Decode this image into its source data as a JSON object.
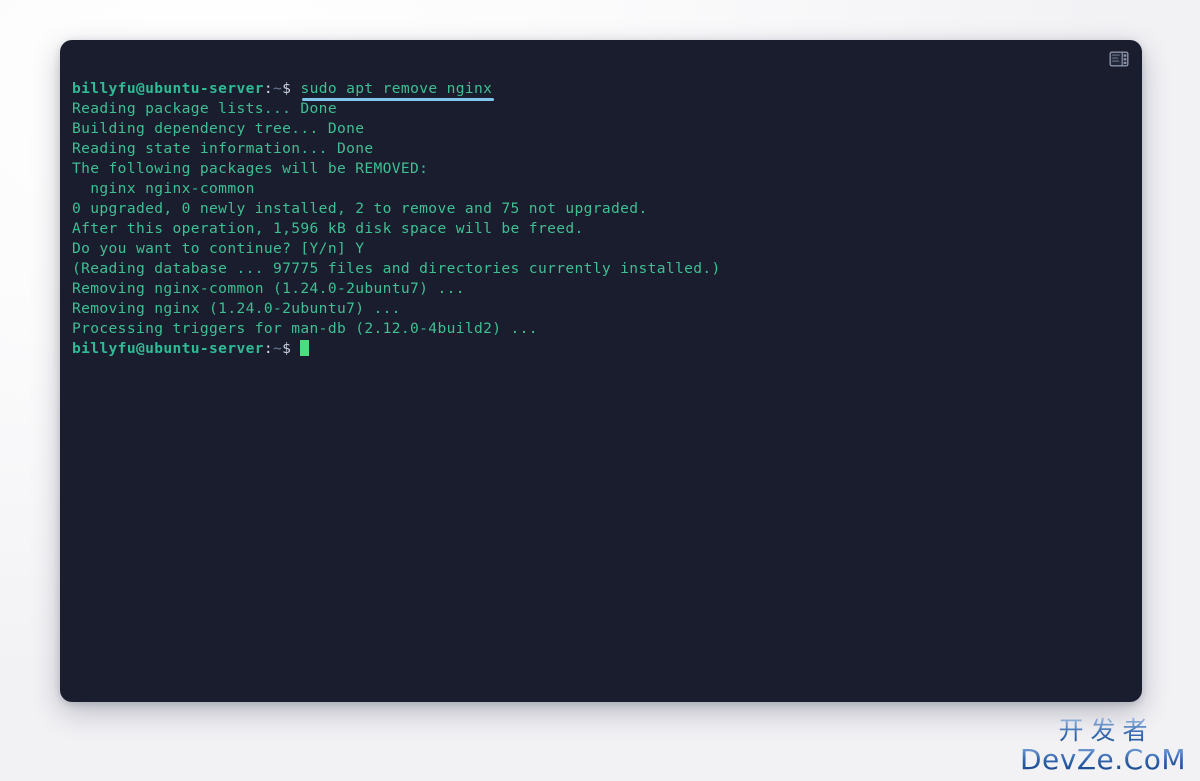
{
  "page": {
    "background_color": "#f4f4f7"
  },
  "terminal": {
    "background_color": "#191d2e",
    "text_color": "#3fbf92",
    "prompt_color": "#2fbb94",
    "underline_color": "#7fc6ea",
    "cursor_color": "#4ade80",
    "titlebar": {
      "panel_toggle_icon": "panel-layout-icon"
    },
    "prompt": {
      "user_host": "billyfu@ubuntu-server",
      "colon": ":",
      "path": "~",
      "symbol": "$"
    },
    "command": "sudo apt remove nginx",
    "output_lines": [
      "Reading package lists... Done",
      "Building dependency tree... Done",
      "Reading state information... Done",
      "The following packages will be REMOVED:",
      "  nginx nginx-common",
      "0 upgraded, 0 newly installed, 2 to remove and 75 not upgraded.",
      "After this operation, 1,596 kB disk space will be freed.",
      "Do you want to continue? [Y/n] Y",
      "(Reading database ... 97775 files and directories currently installed.)",
      "Removing nginx-common (1.24.0-2ubuntu7) ...",
      "Removing nginx (1.24.0-2ubuntu7) ...",
      "Processing triggers for man-db (2.12.0-4build2) ..."
    ]
  },
  "watermark": {
    "chinese": "开发者",
    "latin": "DevZe.CoM"
  }
}
